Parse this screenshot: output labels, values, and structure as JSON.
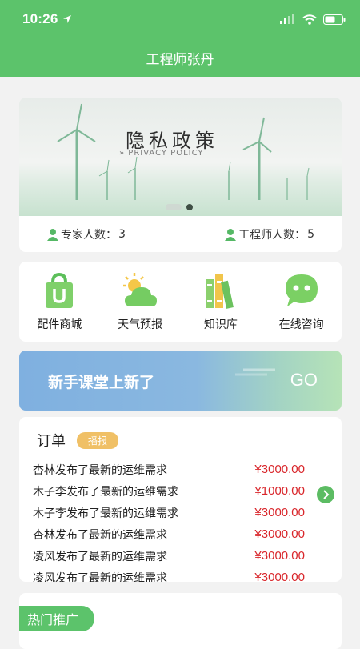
{
  "status_bar": {
    "time": "10:26"
  },
  "header": {
    "title": "工程师张丹"
  },
  "banner": {
    "title": "隐私政策",
    "subtitle": "» PRIVACY POLICY",
    "stats": [
      {
        "label": "专家人数：",
        "value": "3"
      },
      {
        "label": "工程师人数：",
        "value": "5"
      }
    ]
  },
  "menu": {
    "items": [
      {
        "label": "配件商城",
        "icon": "shopping-bag-icon"
      },
      {
        "label": "天气预报",
        "icon": "weather-icon"
      },
      {
        "label": "知识库",
        "icon": "books-icon"
      },
      {
        "label": "在线咨询",
        "icon": "chat-icon"
      }
    ]
  },
  "promo": {
    "text": "新手课堂上新了",
    "go": "GO"
  },
  "orders": {
    "title": "订单",
    "badge": "播报",
    "rows": [
      {
        "text": "杏林发布了最新的运维需求",
        "amount": "¥3000.00"
      },
      {
        "text": "木子李发布了最新的运维需求",
        "amount": "¥1000.00"
      },
      {
        "text": "木子李发布了最新的运维需求",
        "amount": "¥3000.00"
      },
      {
        "text": "杏林发布了最新的运维需求",
        "amount": "¥3000.00"
      },
      {
        "text": "凌风发布了最新的运维需求",
        "amount": "¥3000.00"
      },
      {
        "text": "凌风发布了最新的运维需求",
        "amount": "¥3000.00"
      }
    ]
  },
  "hot": {
    "label": "热门推广"
  },
  "colors": {
    "brand_green": "#5cc36b",
    "price_red": "#d9262b",
    "badge_orange": "#f0c066"
  }
}
